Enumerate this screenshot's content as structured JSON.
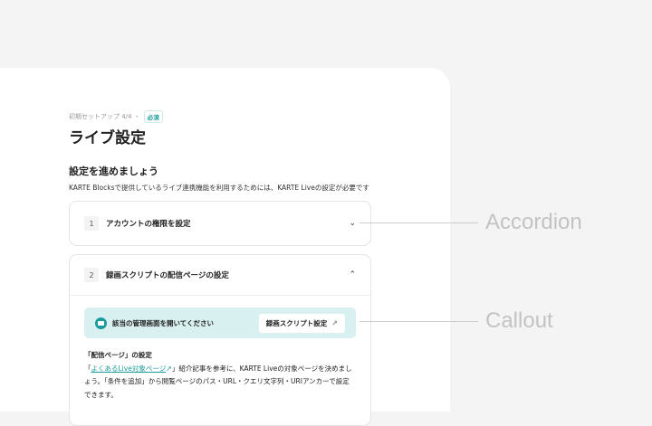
{
  "breadcrumb": {
    "step": "初期セットアップ 4/4 ・",
    "badge": "必須"
  },
  "page_title": "ライブ設定",
  "section_title": "設定を進めましょう",
  "description": "KARTE Blocksで提供しているライブ連携機能を利用するためには、KARTE Liveの設定が必要です",
  "accordions": [
    {
      "number": "1",
      "title": "アカウントの権限を設定",
      "state": "collapsed"
    },
    {
      "number": "2",
      "title": "録画スクリプトの配信ページの設定",
      "state": "expanded",
      "callout": {
        "text": "該当の管理画面を開いてください",
        "button": "録画スクリプト設定"
      },
      "body": {
        "heading": "「配信ページ」の設定",
        "pre": "「",
        "link": "よくあるLive対象ページ",
        "post": "」紹介記事を参考に、KARTE Liveの対象ページを決めましょう。「条件を追加」から閲覧ページのパス・URL・クエリ文字列・URIアンカーで設定できます。"
      }
    }
  ],
  "annotations": {
    "accordion": "Accordion",
    "callout": "Callout"
  }
}
